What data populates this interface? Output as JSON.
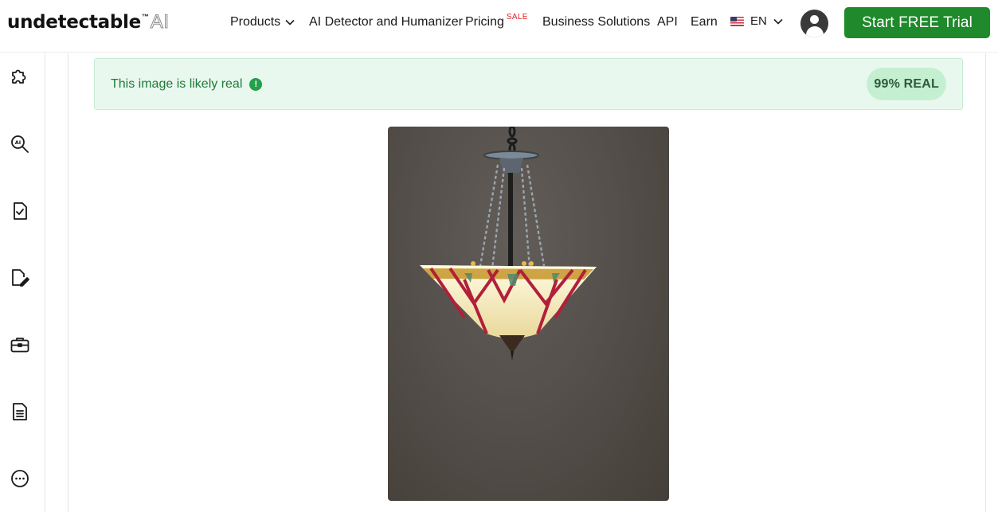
{
  "header": {
    "logo_text": "undetectable",
    "logo_tm": "™",
    "logo_suffix": "AI",
    "nav": {
      "products": "Products",
      "detector": "AI Detector and Humanizer",
      "pricing": "Pricing",
      "pricing_badge": "SALE",
      "business": "Business Solutions",
      "api": "API",
      "earn": "Earn"
    },
    "language": "EN",
    "cta_label": "Start FREE Trial"
  },
  "sidebar": {
    "items": [
      {
        "icon": "puzzle-icon"
      },
      {
        "icon": "ai-search-icon"
      },
      {
        "icon": "document-check-icon"
      },
      {
        "icon": "document-edit-icon"
      },
      {
        "icon": "briefcase-icon"
      },
      {
        "icon": "document-lines-icon"
      },
      {
        "icon": "more-icon"
      }
    ]
  },
  "result": {
    "message": "This image is likely real",
    "score": "99% REAL",
    "status_color": "#1e8a2b"
  },
  "colors": {
    "brand_green": "#1e8a2b",
    "sale_red": "#e02020",
    "banner_bg": "#e9f8ee"
  }
}
